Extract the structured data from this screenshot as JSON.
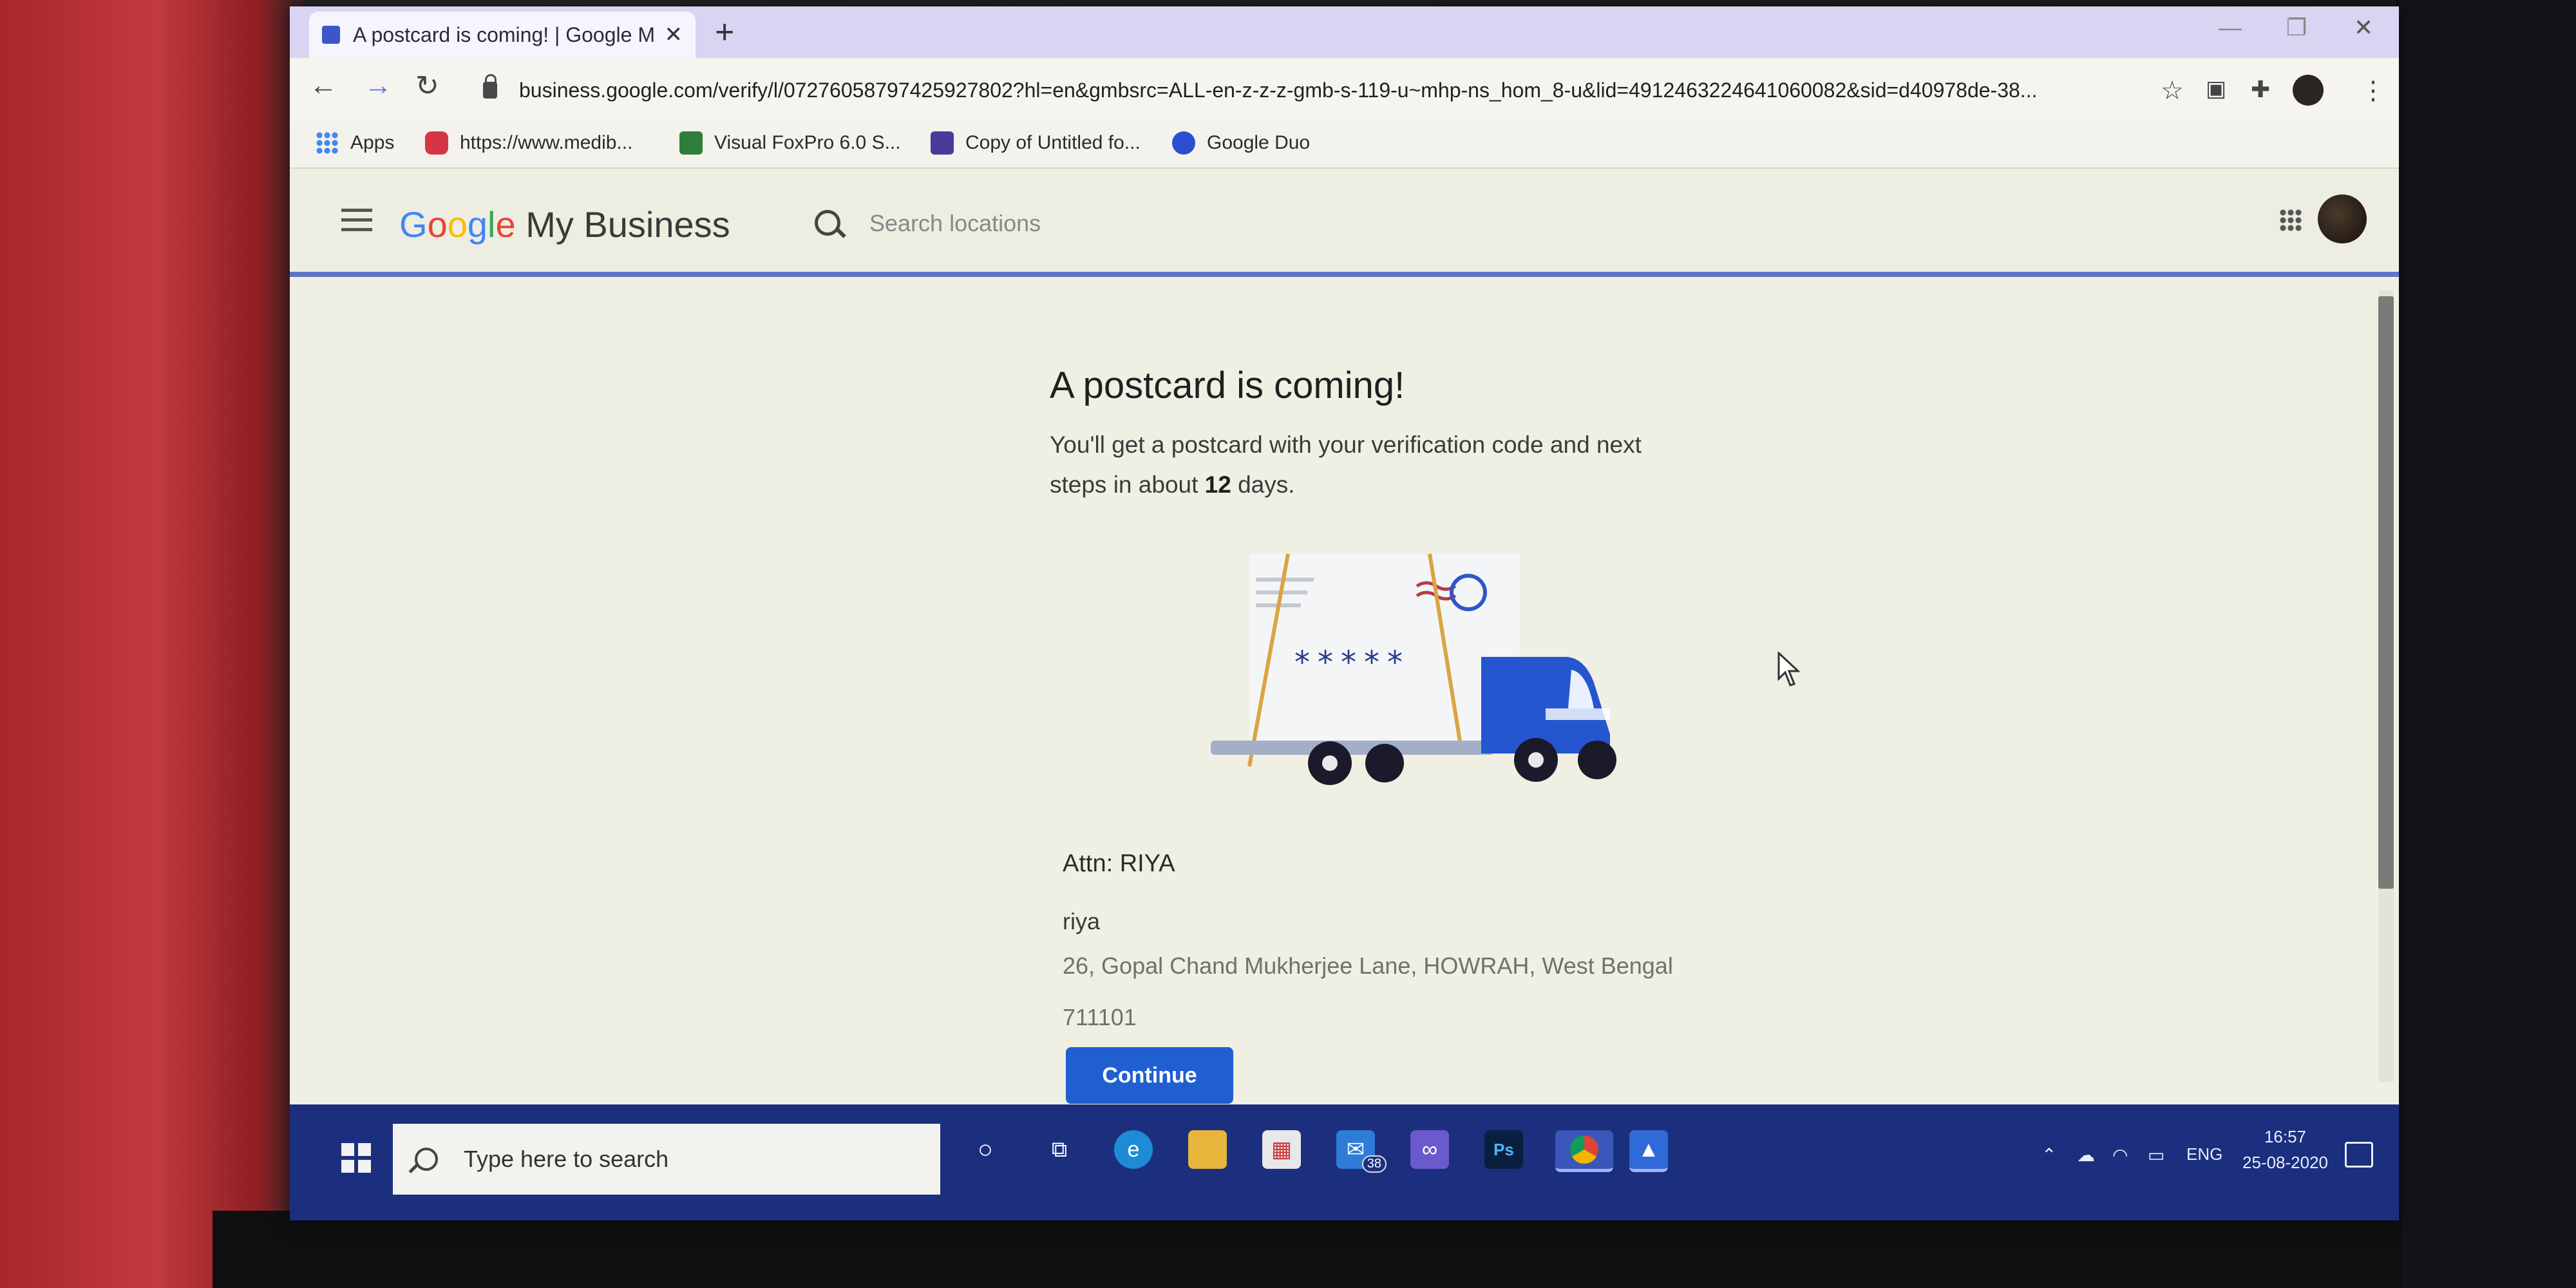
{
  "browser": {
    "tab_title": "A postcard is coming! | Google M",
    "url": "business.google.com/verify/l/07276058797425927802?hl=en&gmbsrc=ALL-en-z-z-z-gmb-s-119-u~mhp-ns_hom_8-u&lid=4912463224641060082&sid=d40978de-38..."
  },
  "bookmarks": [
    {
      "label": "Apps",
      "icon": "apps-grid-icon"
    },
    {
      "label": "https://www.medib...",
      "icon": "pocket-icon"
    },
    {
      "label": "Visual FoxPro 6.0 S...",
      "icon": "download-bookmark-icon"
    },
    {
      "label": "Copy of Untitled fo...",
      "icon": "forms-icon"
    },
    {
      "label": "Google Duo",
      "icon": "duo-icon"
    }
  ],
  "app": {
    "logo_google": "Google",
    "logo_rest": " My Business",
    "search_placeholder": "Search locations"
  },
  "content": {
    "heading": "A postcard is coming!",
    "sub_before": "You'll get a postcard with your verification code and next steps in about ",
    "days": "12",
    "sub_after": " days.",
    "code_mask": "*****",
    "attn": "Attn: RIYA",
    "name": "riya",
    "address": "26, Gopal Chand Mukherjee Lane, HOWRAH, West Bengal 711101",
    "continue_label": "Continue"
  },
  "taskbar": {
    "search_placeholder": "Type here to search",
    "mail_badge": "38",
    "lang": "ENG",
    "time": "16:57",
    "date": "25-08-2020"
  },
  "colors": {
    "brand_blue": "#1f5fd0",
    "taskbar": "#1c2f7e",
    "header_rule": "#5f73c8"
  }
}
